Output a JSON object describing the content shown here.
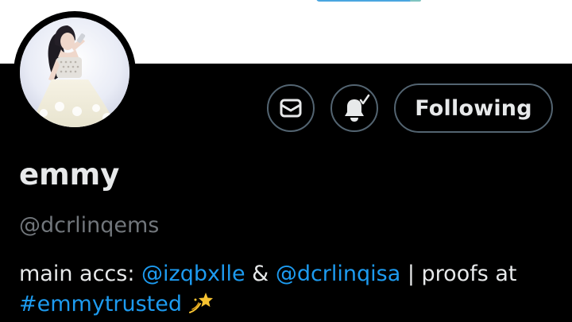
{
  "profile": {
    "display_name": "emmy",
    "handle": "@dcrlinqems"
  },
  "actions": {
    "message_icon": "envelope-icon",
    "notify_icon": "bell-check-icon",
    "follow_label": "Following"
  },
  "bio": {
    "prefix": "main accs: ",
    "mention1": "@izqbxlle",
    "amp": " & ",
    "mention2": "@dcrlinqisa",
    "mid": " | proofs at",
    "hashtag": "#emmytrusted",
    "emoji": "dizzy-star-emoji"
  },
  "colors": {
    "background": "#000000",
    "text": "#e7e9ea",
    "secondary_text": "#71767b",
    "link": "#1d9bf0",
    "border": "#536471"
  }
}
